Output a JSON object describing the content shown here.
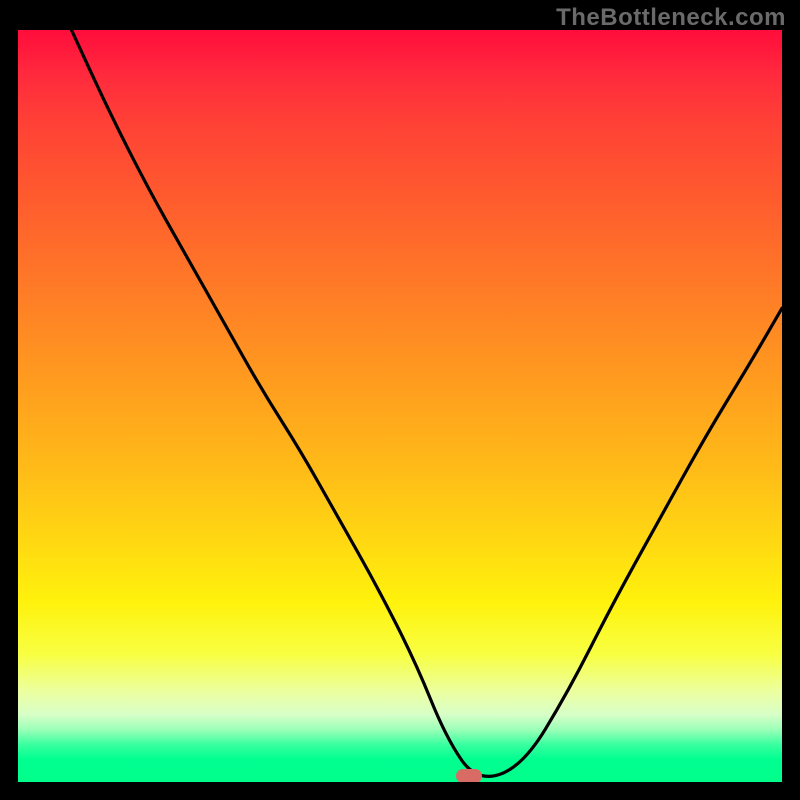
{
  "watermark": "TheBottleneck.com",
  "chart_data": {
    "type": "line",
    "title": "",
    "xlabel": "",
    "ylabel": "",
    "xlim": [
      0,
      100
    ],
    "ylim": [
      0,
      100
    ],
    "grid": false,
    "legend": false,
    "series": [
      {
        "name": "bottleneck-curve",
        "x": [
          7,
          12,
          17,
          22,
          27,
          32,
          37,
          42,
          47,
          52,
          56,
          60,
          66,
          72,
          78,
          84,
          90,
          96,
          100
        ],
        "values": [
          100,
          89,
          79,
          70,
          61,
          52,
          44,
          35,
          26,
          16,
          6,
          0,
          2,
          12,
          24,
          35,
          46,
          56,
          63
        ]
      }
    ],
    "marker": {
      "x": 59,
      "y": 0,
      "color": "#d86b63"
    },
    "background_gradient": {
      "direction": "vertical",
      "stops": [
        {
          "pos": 0,
          "color": "#ff0d3c"
        },
        {
          "pos": 22,
          "color": "#ff5a2e"
        },
        {
          "pos": 46,
          "color": "#ff9a1f"
        },
        {
          "pos": 68,
          "color": "#ffd812"
        },
        {
          "pos": 83,
          "color": "#f8ff42"
        },
        {
          "pos": 95,
          "color": "#3affa0"
        },
        {
          "pos": 100,
          "color": "#00ff8a"
        }
      ]
    }
  }
}
